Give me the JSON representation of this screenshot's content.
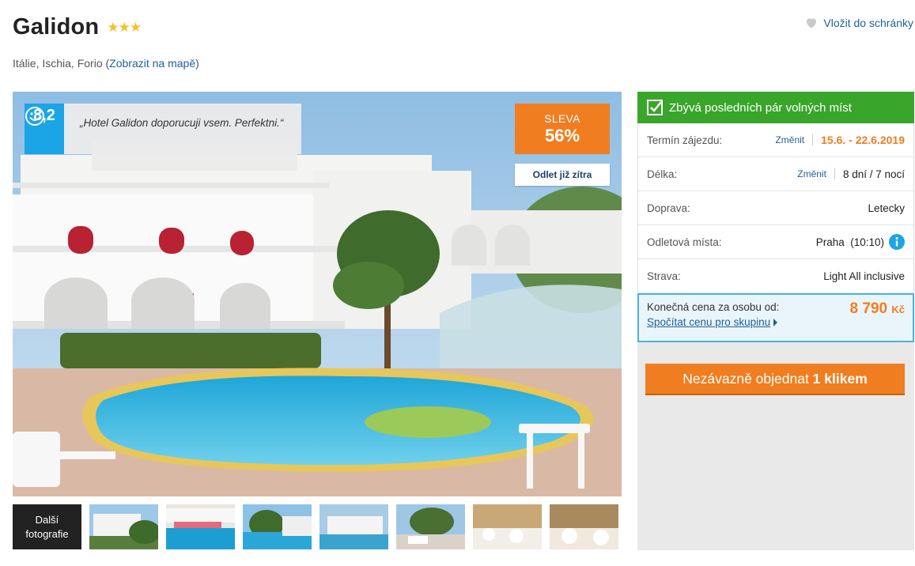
{
  "hotel": {
    "name": "Galidon",
    "stars": "★★★",
    "location_text": "Itálie, Ischia, Forio (",
    "map_link": "Zobrazit na mapě",
    "location_close": ")"
  },
  "favorite": {
    "label": "Vložit do schránky",
    "icon": "heart-icon"
  },
  "rating": {
    "score": "8,2",
    "quote": "„Hotel Galidon doporucuji vsem. Perfektni.“"
  },
  "discount": {
    "label": "SLEVA",
    "value": "56%"
  },
  "departure_badge": "Odlet již zítra",
  "more_photos": {
    "line1": "Další",
    "line2": "fotografie"
  },
  "panel": {
    "availability": "Zbývá posledních pár volných míst",
    "rows": [
      {
        "label": "Termín zájezdu:",
        "change": "Změnit",
        "value": "15.6. - 22.6.2019"
      },
      {
        "label": "Délka:",
        "change": "Změnit",
        "value": "8 dní / 7 nocí"
      },
      {
        "label": "Doprava:",
        "value": "Letecky"
      },
      {
        "label": "Odletová místa:",
        "value": "Praha  (10:10)"
      },
      {
        "label": "Strava:",
        "value": "Light All inclusive"
      }
    ],
    "price_label": "Konečná cena za osobu od:",
    "price_value": "8 790",
    "price_currency": "Kč",
    "group_link": "Spočítat cenu pro skupinu",
    "order_button_prefix": "Nezávazně objednat ",
    "order_button_bold": "1 klikem"
  },
  "colors": {
    "accent_orange": "#f07d1f",
    "link_blue": "#1f5f9c",
    "green": "#3aa52b",
    "rating_blue": "#1ba5e6"
  }
}
